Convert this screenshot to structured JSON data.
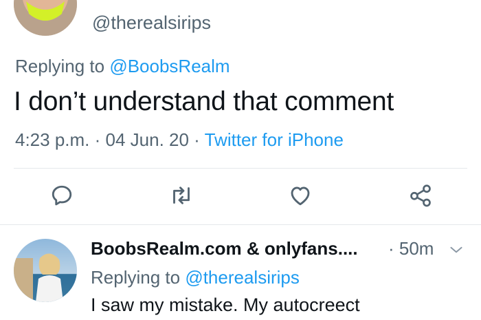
{
  "main_tweet": {
    "handle": "@therealsirips",
    "replying_prefix": "Replying to ",
    "replying_to": "@BoobsRealm",
    "text": "I don’t understand that comment",
    "time": "4:23 p.m.",
    "separator": " · ",
    "date": "04 Jun. 20",
    "source": "Twitter for iPhone"
  },
  "actions": {
    "icons": [
      "reply-icon",
      "retweet-icon",
      "like-icon",
      "share-icon"
    ]
  },
  "reply_tweet": {
    "display_name": "BoobsRealm.com & onlyfans....",
    "time": "· 50m",
    "replying_prefix": "Replying to ",
    "replying_to": "@therealsirips",
    "text": "I saw my mistake. My autocreect"
  },
  "colors": {
    "link": "#1d9bf0",
    "secondary_text": "#536471",
    "primary_text": "#0f1419",
    "divider": "#e5e8eb"
  }
}
